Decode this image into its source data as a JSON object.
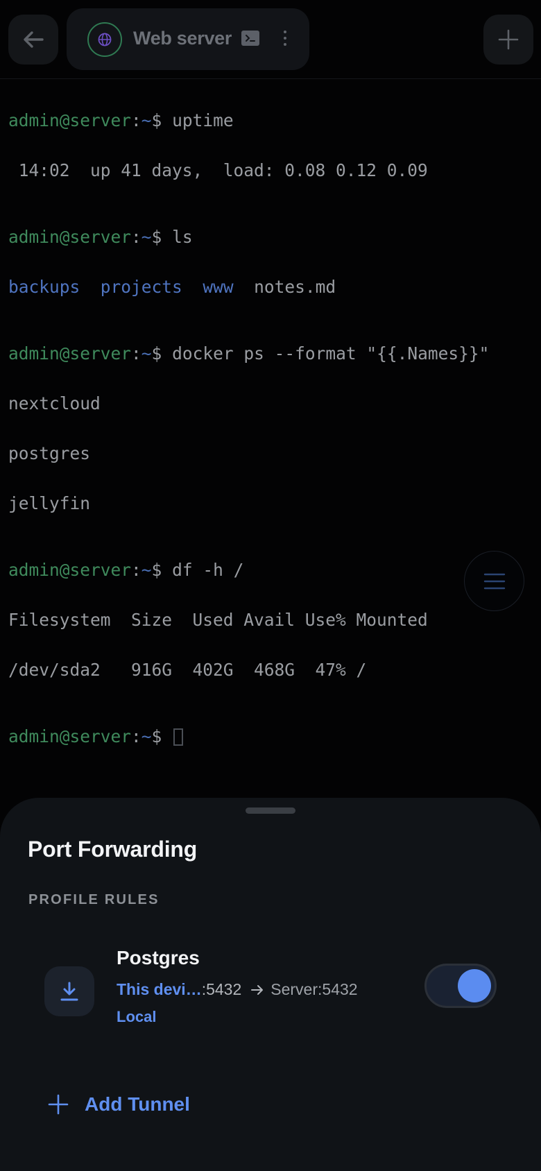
{
  "header": {
    "session_title": "Web server"
  },
  "terminal": {
    "prompt_user": "admin@server",
    "prompt_path": "~",
    "prompt_symbol": "$",
    "commands": {
      "uptime": "uptime",
      "ls": "ls",
      "docker": "docker ps --format \"{{.Names}}\"",
      "df": "df -h /"
    },
    "uptime_output": " 14:02  up 41 days,  load: 0.08 0.12 0.09",
    "ls_output": {
      "dir_backups": "backups",
      "dir_projects": "projects",
      "dir_www": "www",
      "file_notes": "notes.md"
    },
    "docker_output": [
      "nextcloud",
      "postgres",
      "jellyfin"
    ],
    "df_output": {
      "header": "Filesystem  Size  Used Avail Use% Mounted",
      "row": "/dev/sda2   916G  402G  468G  47% /"
    }
  },
  "sheet": {
    "title": "Port Forwarding",
    "section_label": "PROFILE RULES",
    "rule": {
      "name": "Postgres",
      "source_host": "This devi…",
      "source_port": ":5432",
      "destination": "Server:5432",
      "type": "Local",
      "enabled": true
    },
    "add_tunnel_label": "Add Tunnel"
  },
  "colors": {
    "accent": "#5f8ff0",
    "prompt_green": "#3f8a5c",
    "background": "#030304",
    "sheet_bg": "#101317"
  }
}
